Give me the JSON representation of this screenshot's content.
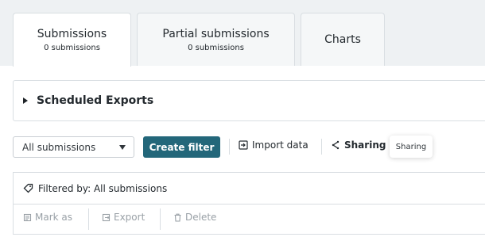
{
  "tabs": [
    {
      "label": "Submissions",
      "count": "0 submissions",
      "active": true
    },
    {
      "label": "Partial submissions",
      "count": "0 submissions"
    },
    {
      "label": "Charts"
    }
  ],
  "scheduled_exports": {
    "title": "Scheduled Exports"
  },
  "toolbar": {
    "filter_select": {
      "value": "All submissions"
    },
    "create_filter": "Create filter",
    "import_data": "Import data",
    "sharing": "Sharing",
    "tooltip": "Sharing"
  },
  "filtered_by": "Filtered by: All submissions",
  "actions": {
    "mark_as": "Mark as",
    "export": "Export",
    "delete": "Delete"
  },
  "colors": {
    "accent": "#23677a",
    "muted": "#9aa1a7"
  }
}
